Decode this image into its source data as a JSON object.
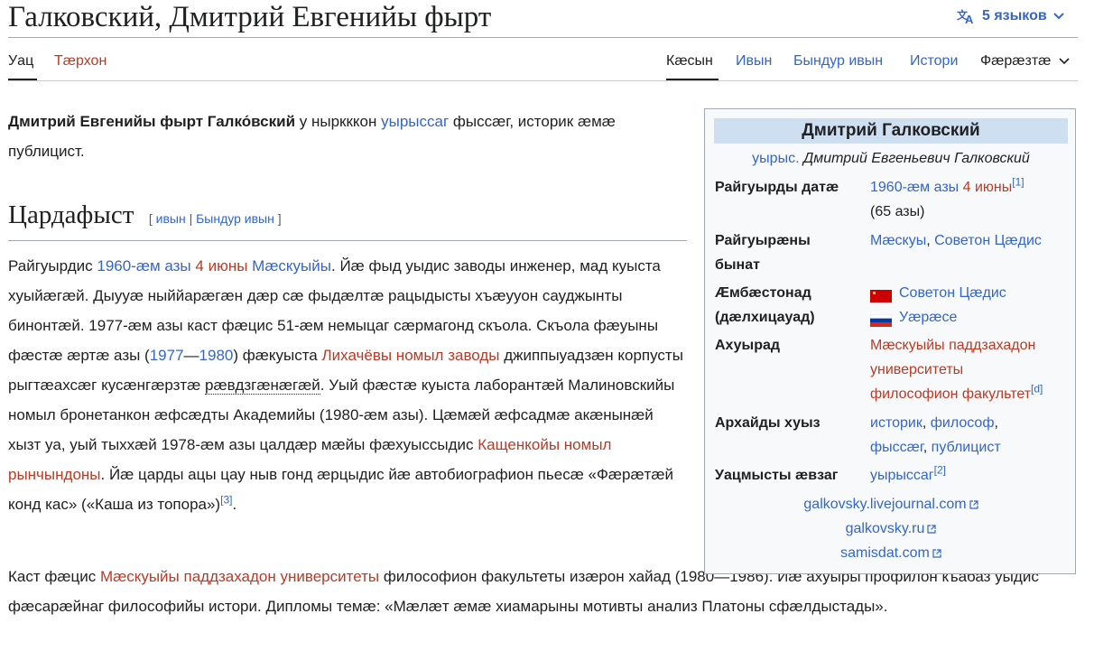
{
  "header": {
    "title": "Галковский, Дмитрий Евгенийы фырт",
    "languages": "5 языков"
  },
  "tabs": {
    "left": [
      "Уац",
      "Тæрхон"
    ],
    "right": [
      "Кæсын",
      "Ивын",
      "Бындур ивын",
      "Истори",
      "Фæрæзтæ"
    ]
  },
  "intro": {
    "name_bold": "Дмитрий Евгенийы фырт Галко́вский",
    "t1": " у ныркккон ",
    "link1": "уырыссаг",
    "t2": " фыссæг, историк æмæ публицист."
  },
  "section": {
    "title": "Цардафыст",
    "edit_open": "[",
    "edit": "ивын",
    "sep": "|",
    "edit_source": "Бындур ивын",
    "edit_close": "]"
  },
  "bio": {
    "t1": "Райгуырдис ",
    "date1": "1960-æм азы",
    "date2": "4 июны",
    "place": "Мæскуыйы",
    "t2": ". Йæ фыд уыдис заводы инженер, мад куыста хуыйæгæй. Дыууæ ныййарæгæн дæр сæ фыдæлтæ рацыдысты хъæууон сауджынты бинонтæй. 1977-æм азы каст фæцис 51-æм немыцаг сæрмагонд скъола. Скъола фæуыны фæстæ æртæ азы (",
    "y1": "1977",
    "dash": "—",
    "y2": "1980",
    "t3": ") фæкуыста ",
    "plant": "Лихачёвы номыл заводы",
    "t4": " джиппыуадзæн корпусты рыгтæахсæг кусæнгæрзтæ ",
    "dotted": "рæвдзгæнæгæй",
    "t5": ". Уый фæстæ куыста лаборантæй Малиновскийы номыл бронетанкон æфсæдты Академийы (1980-æм азы). Цæмæй æфсадмæ акæнынæй хызт уа, уый тыххæй 1978-æм азы цалдæр мæйы фæхуыссыдис ",
    "hospital": "Кащенкойы номыл рынчындоны",
    "t6": ". Йæ царды ацы цау ныв гонд æрцыдис йæ автобиографион пьесæ «Фæрæтæй конд кас» («Каша из топора»)",
    "ref": "[3]",
    "t7": "."
  },
  "edu": {
    "t1": "Каст фæцис ",
    "univ": "Мæскуыйы паддзахадон университеты",
    "t2": " философион факультеты изæрон хайад (1980—1986). Йæ ахуыры профилон къабаз уыдис фæсарæйнаг философийы истори. Дипломы темæ: «Мæлæт æмæ хиамарыны мотивты анализ Платоны сфæлдыстады»."
  },
  "infobox": {
    "title": "Дмитрий Галковский",
    "sub_link": "уырыс.",
    "sub_text": " Дмитрий Евгеньевич Галковский",
    "birth_label": "Райгуырды датæ",
    "birth_year": "1960-æм азы",
    "birth_day": "4 июны",
    "birth_ref": "[1]",
    "birth_age": "(65 азы)",
    "place_label1": "Райгуырæны",
    "place_label2": "бынат",
    "place_v1": "Мæскуы",
    "place_comma": ", ",
    "place_v2": "Советон Цæдис",
    "cit_label1": "Æмбæстонад",
    "cit_label2": "(дæлхицауад)",
    "cit_v1": "Советон Цæдис",
    "cit_v2": "Уæрæсе",
    "edu_label": "Ахуырад",
    "edu_v1": "Мæскуыйы паддзахадон",
    "edu_v2": "университеты",
    "edu_v3": "философион факультет",
    "edu_ref": "[d]",
    "occ_label": "Архайды хуыз",
    "occ_v1": "историк",
    "occ_v2": "философ",
    "occ_v3": "фыссæг",
    "occ_v4": "публицист",
    "lang_label": "Уацмысты æвзаг",
    "lang_v": "уырыссаг",
    "lang_ref": "[2]",
    "links": [
      "galkovsky.livejournal.com",
      "galkovsky.ru",
      "samisdat.com"
    ]
  },
  "colors": {
    "link": "#3366cc",
    "redlink": "#ba3a25",
    "infobox_header": "#cedff2"
  }
}
